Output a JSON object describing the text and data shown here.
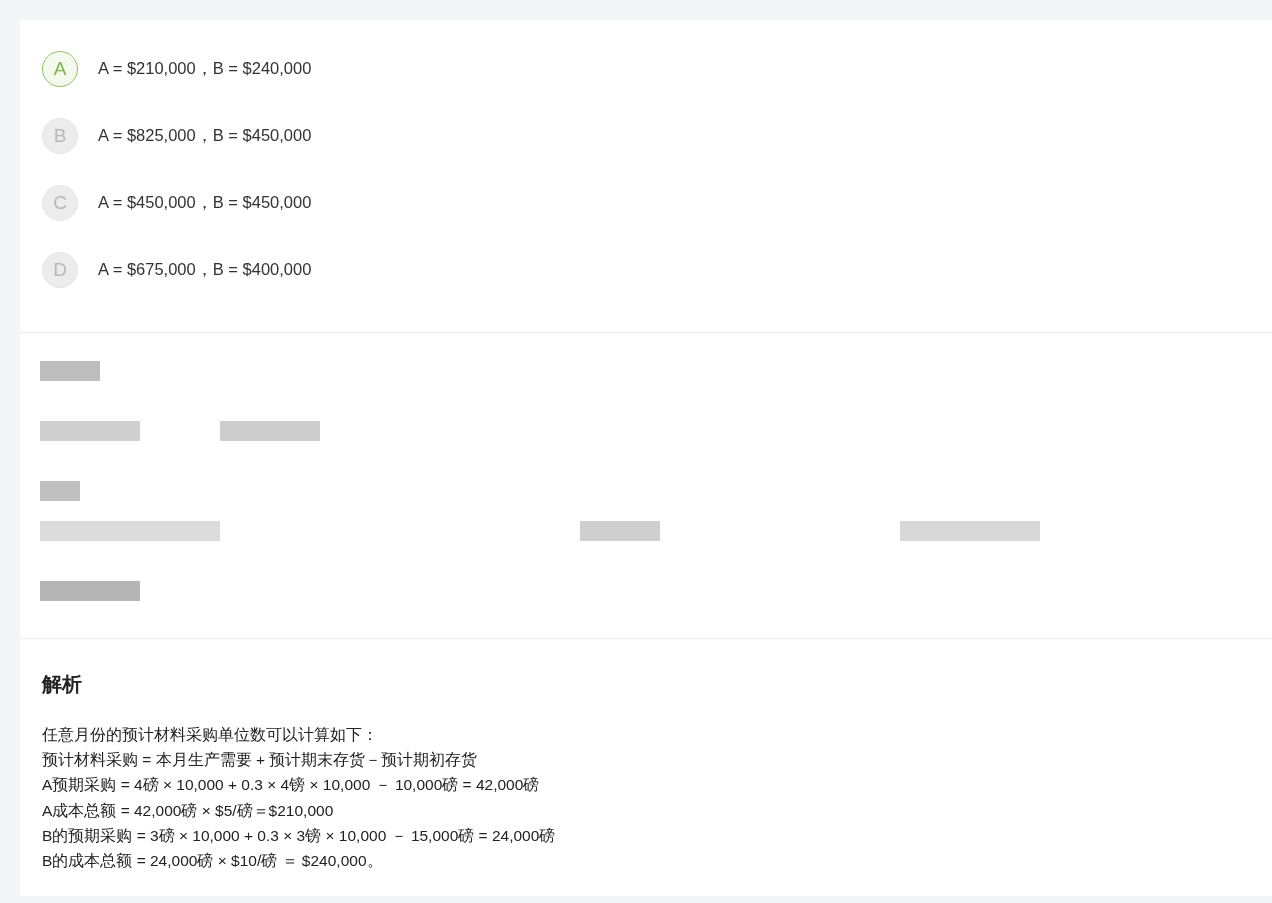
{
  "options": [
    {
      "letter": "A",
      "text": "A = $210,000，B = $240,000",
      "selected": true
    },
    {
      "letter": "B",
      "text": "A = $825,000，B = $450,000",
      "selected": false
    },
    {
      "letter": "C",
      "text": "A = $450,000，B = $450,000",
      "selected": false
    },
    {
      "letter": "D",
      "text": "A = $675,000，B = $400,000",
      "selected": false
    }
  ],
  "analysis": {
    "title": "解析",
    "lines": [
      "任意月份的预计材料采购单位数可以计算如下：",
      "预计材料采购 = 本月生产需要 + 预计期末存货－预计期初存货",
      "A预期采购 = 4磅 × 10,000 + 0.3 × 4镑 × 10,000 － 10,000磅 = 42,000磅",
      "A成本总额 = 42,000磅 × $5/磅＝$210,000",
      "B的预期采购 = 3磅 × 10,000 + 0.3 × 3镑 × 10,000 － 15,000磅 = 24,000磅",
      "B的成本总额 = 24,000磅 × $10/磅 ＝ $240,000。"
    ]
  }
}
